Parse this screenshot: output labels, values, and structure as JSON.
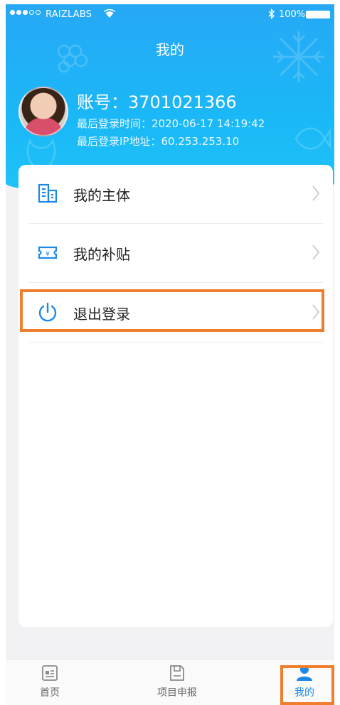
{
  "status_bar": {
    "carrier": "RAIZLABS",
    "battery": "100%"
  },
  "header": {
    "title": "我的"
  },
  "profile": {
    "account_label": "账号：",
    "account_number": "3701021366",
    "last_login_time_label": "最后登录时间：",
    "last_login_time": "2020-06-17 14:19:42",
    "last_login_ip_label": "最后登录IP地址：",
    "last_login_ip": "60.253.253.10"
  },
  "menu": [
    {
      "label": "我的主体",
      "icon": "building-icon"
    },
    {
      "label": "我的补贴",
      "icon": "subsidy-ticket-icon"
    },
    {
      "label": "退出登录",
      "icon": "power-icon"
    }
  ],
  "tabbar": [
    {
      "label": "首页",
      "icon": "home-news-icon",
      "active": false
    },
    {
      "label": "项目申报",
      "icon": "project-file-icon",
      "active": false
    },
    {
      "label": "我的",
      "icon": "user-icon",
      "active": true
    }
  ],
  "colors": {
    "header_blue": "#1ab8f7",
    "accent_blue": "#1e88e5",
    "highlight_orange": "#ef7f2e"
  }
}
